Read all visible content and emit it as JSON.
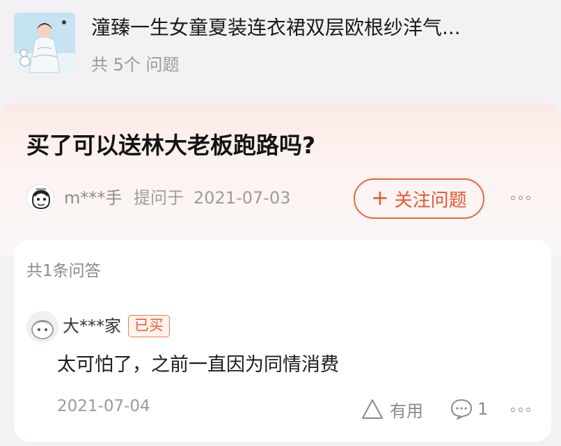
{
  "product": {
    "title": "潼臻一生女童夏装连衣裙双层欧根纱洋气...",
    "question_count": "共 5个 问题",
    "thumbnail_icon": "product-photo-icon"
  },
  "question": {
    "title": "买了可以送林大老板跑路吗?",
    "asker_name": "m***手",
    "asked_label": "提问于",
    "asked_date": "2021-07-03",
    "follow_label": "关注问题",
    "follow_icon": "plus-icon",
    "accent_color": "#ec5530"
  },
  "answers": {
    "count_label": "共1条问答",
    "items": [
      {
        "author": "大***家",
        "badge": "已买",
        "text": "太可怕了，之前一直因为同情消费",
        "date": "2021-07-04",
        "useful_label": "有用",
        "comment_count": "1"
      }
    ]
  }
}
